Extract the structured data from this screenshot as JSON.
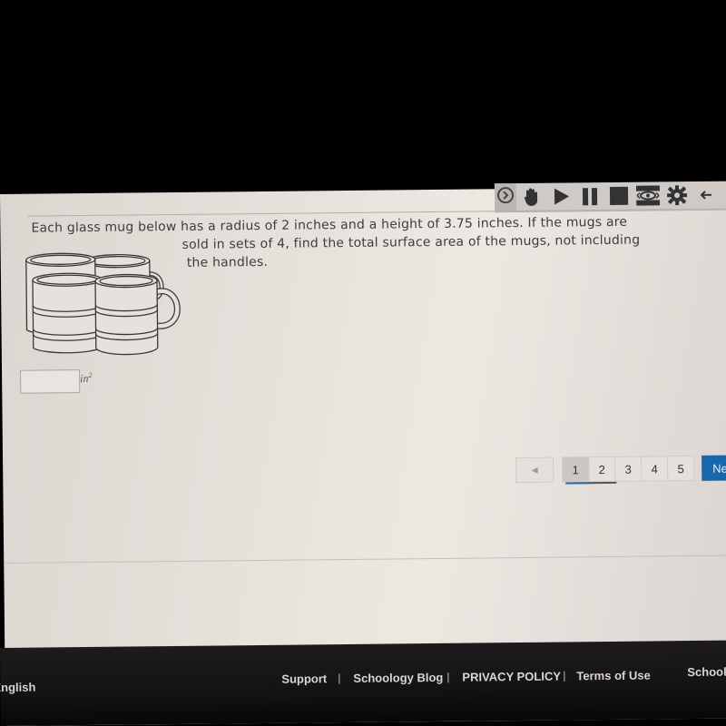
{
  "toolbar": {
    "icons": [
      "chevron-right-circle-icon",
      "hand-icon",
      "play-icon",
      "pause-icon",
      "stop-icon",
      "eye-mask-icon",
      "gear-icon",
      "arrow-left-icon"
    ]
  },
  "question": {
    "line1": "Each glass mug below has a radius of 2 inches and a height of 3.75 inches. If the mugs are",
    "line2": "sold in sets of 4, find the total surface area of the mugs, not including",
    "line3": "the handles.",
    "image_alt": "four glass mugs"
  },
  "answer": {
    "value": "",
    "unit": "in",
    "unit_exp": "2"
  },
  "pagination": {
    "prev_label": "◀",
    "pages": [
      "1",
      "2",
      "3",
      "4",
      "5"
    ],
    "current_page": "1",
    "next_label": "Next"
  },
  "footer": {
    "language": "English",
    "links": [
      "Support",
      "Schoology Blog",
      "PRIVACY POLICY",
      "Terms of Use"
    ],
    "separator": "|",
    "brand": "Schoology"
  }
}
